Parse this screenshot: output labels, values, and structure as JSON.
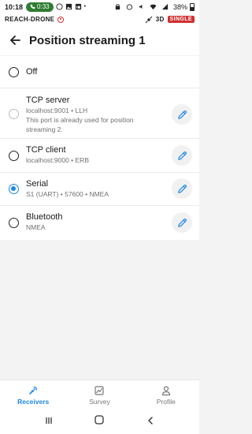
{
  "status_bar": {
    "time": "10:18",
    "call_duration": "0:33",
    "battery": "38%"
  },
  "device_bar": {
    "device_name": "REACH-DRONE",
    "fix_status": "3D",
    "solution_badge": "SINGLE",
    "badge_color": "#d32f2f"
  },
  "header": {
    "title": "Position streaming 1"
  },
  "options": [
    {
      "label": "Off",
      "subtitle": "",
      "note": "",
      "selected": false,
      "disabled": false,
      "editable": false
    },
    {
      "label": "TCP server",
      "subtitle": "localhost:9001 • LLH",
      "note": "This port is already used for position streaming 2.",
      "selected": false,
      "disabled": true,
      "editable": true
    },
    {
      "label": "TCP client",
      "subtitle": "localhost:9000 • ERB",
      "note": "",
      "selected": false,
      "disabled": false,
      "editable": true
    },
    {
      "label": "Serial",
      "subtitle": "S1 (UART) • 57600 • NMEA",
      "note": "",
      "selected": true,
      "disabled": false,
      "editable": true
    },
    {
      "label": "Bluetooth",
      "subtitle": "NMEA",
      "note": "",
      "selected": false,
      "disabled": false,
      "editable": true
    }
  ],
  "bottom_nav": [
    {
      "label": "Receivers",
      "icon": "receivers-icon",
      "active": true
    },
    {
      "label": "Survey",
      "icon": "survey-icon",
      "active": false
    },
    {
      "label": "Profile",
      "icon": "profile-icon",
      "active": false
    }
  ],
  "colors": {
    "accent": "#1e88e5",
    "badge": "#d32f2f",
    "call_pill": "#2e7d32"
  }
}
